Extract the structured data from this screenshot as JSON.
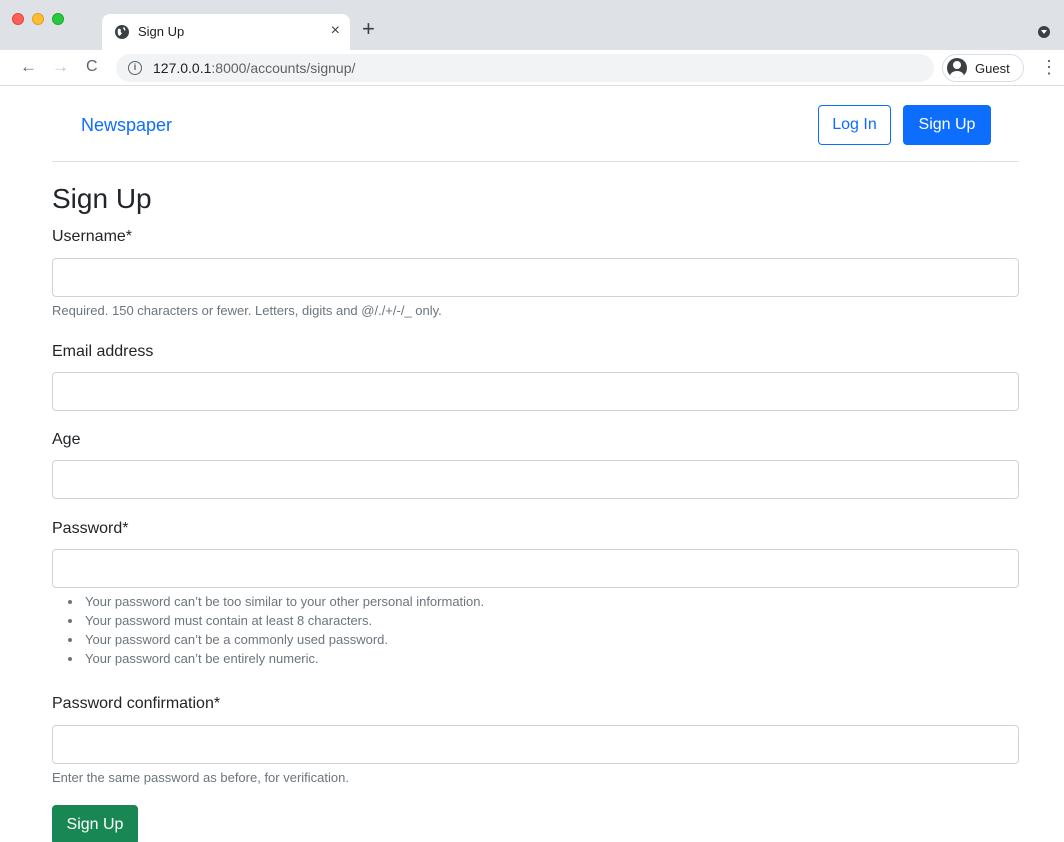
{
  "browser": {
    "tab_title": "Sign Up",
    "tab_close": "×",
    "new_tab": "+",
    "url_host": "127.0.0.1",
    "url_rest": ":8000/accounts/signup/",
    "profile_label": "Guest",
    "back": "←",
    "forward": "→",
    "reload": "C",
    "menu": "⋮",
    "info": "i"
  },
  "navbar": {
    "brand": "Newspaper",
    "login_label": "Log In",
    "signup_label": "Sign Up"
  },
  "form": {
    "heading": "Sign Up",
    "username": {
      "label": "Username*",
      "value": "",
      "help": "Required. 150 characters or fewer. Letters, digits and @/./+/-/_ only."
    },
    "email": {
      "label": "Email address",
      "value": ""
    },
    "age": {
      "label": "Age",
      "value": ""
    },
    "password": {
      "label": "Password*",
      "value": "",
      "rules": [
        "Your password can’t be too similar to your other personal information.",
        "Your password must contain at least 8 characters.",
        "Your password can’t be a commonly used password.",
        "Your password can’t be entirely numeric."
      ]
    },
    "password_confirm": {
      "label": "Password confirmation*",
      "value": "",
      "help": "Enter the same password as before, for verification."
    },
    "submit_label": "Sign Up"
  },
  "colors": {
    "primary": "#0d6efd",
    "success": "#198754",
    "muted": "#6c757d"
  }
}
